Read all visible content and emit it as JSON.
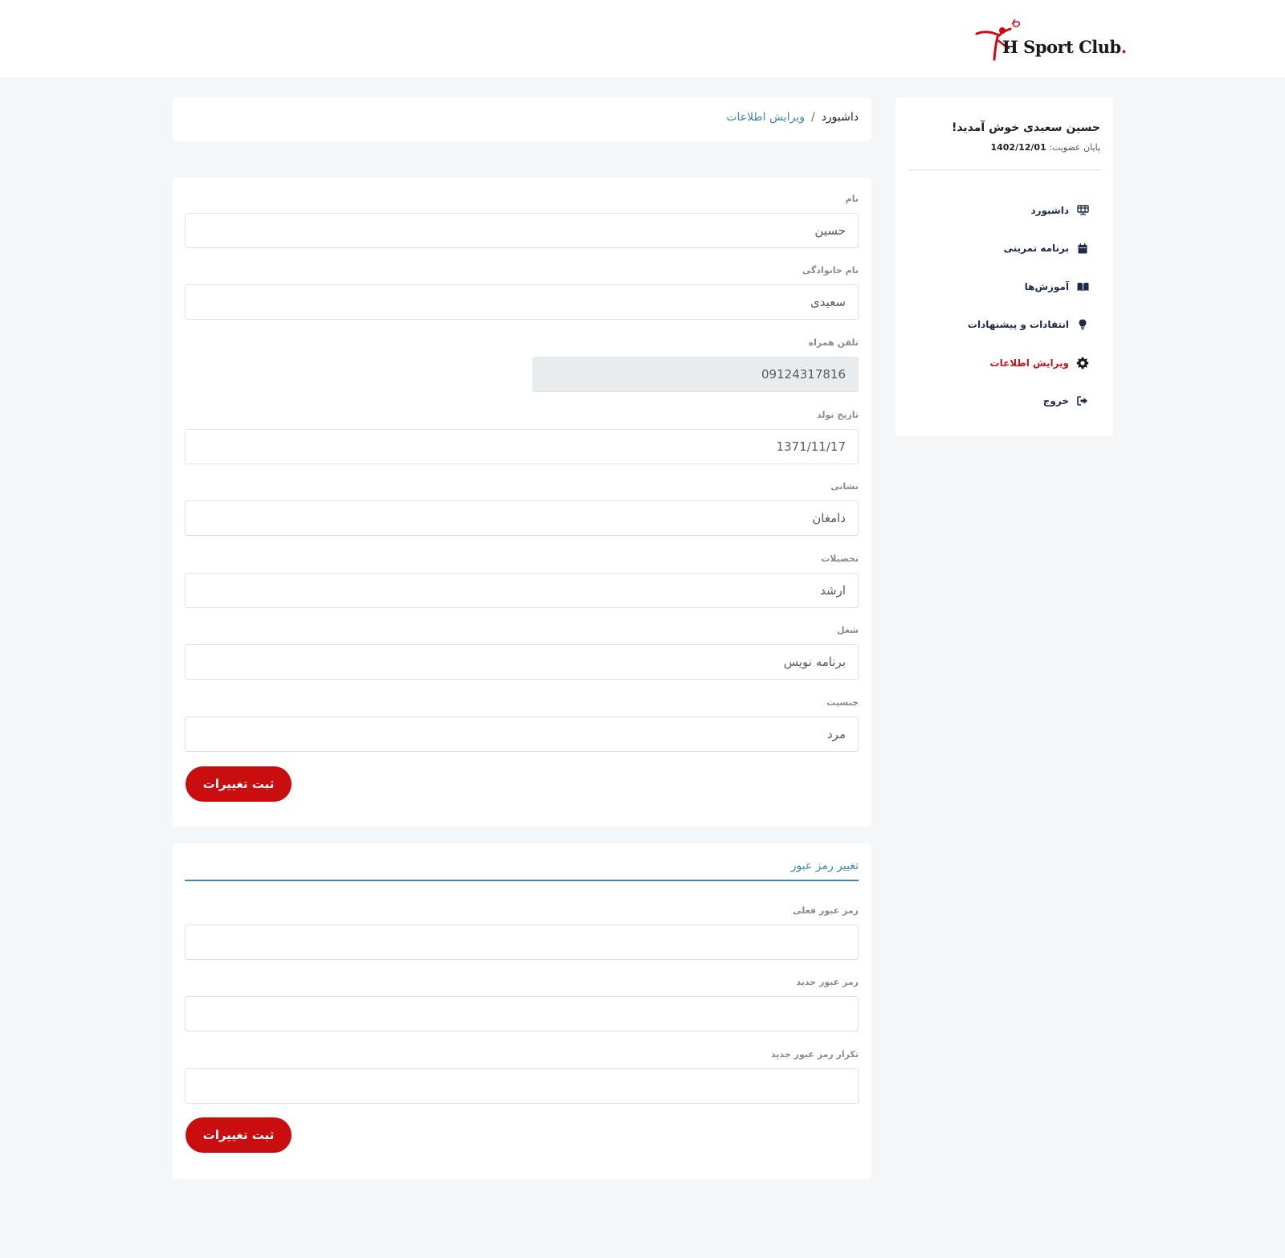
{
  "brand": {
    "name": "H Sport Club",
    "dot": ".",
    "accent": "#c8141b"
  },
  "sidebar": {
    "welcome": "حسین سعیدی خوش آمدید!",
    "membership_label": "پایان عضویت:",
    "membership_date": "1402/12/01",
    "items": [
      {
        "label": "داشبورد",
        "icon": "dashboard-icon"
      },
      {
        "label": "برنامه تمرینی",
        "icon": "calendar-icon"
      },
      {
        "label": "آموزش‌ها",
        "icon": "book-icon"
      },
      {
        "label": "انتقادات و پیشنهادات",
        "icon": "lightbulb-icon"
      },
      {
        "label": "ویرایش اطلاعات",
        "icon": "gear-icon"
      },
      {
        "label": "خروج",
        "icon": "logout-icon"
      }
    ]
  },
  "breadcrumb": {
    "home": "داشبورد",
    "separator": "/",
    "current": "ویرایش اطلاعات"
  },
  "profile_form": {
    "first_name": {
      "label": "نام",
      "value": "حسین"
    },
    "last_name": {
      "label": "نام خانوادگی",
      "value": "سعیدی"
    },
    "phone": {
      "label": "تلفن همراه",
      "value": "09124317816"
    },
    "birth_date": {
      "label": "تاریخ تولد",
      "value": "1371/11/17"
    },
    "address": {
      "label": "نشانی",
      "value": "دامغان"
    },
    "education": {
      "label": "تحصیلات",
      "value": "ارشد"
    },
    "job": {
      "label": "شغل",
      "value": "برنامه نویس"
    },
    "gender": {
      "label": "جنسیت",
      "value": "مرد"
    },
    "submit_label": "ثبت تغییرات"
  },
  "password_form": {
    "title": "تغییر رمز عبور",
    "current": {
      "label": "رمز عبور فعلی",
      "value": ""
    },
    "new": {
      "label": "رمز عبور جدید",
      "value": ""
    },
    "confirm": {
      "label": "تکرار رمز عبور جدید",
      "value": ""
    },
    "submit_label": "ثبت تغییرات"
  }
}
